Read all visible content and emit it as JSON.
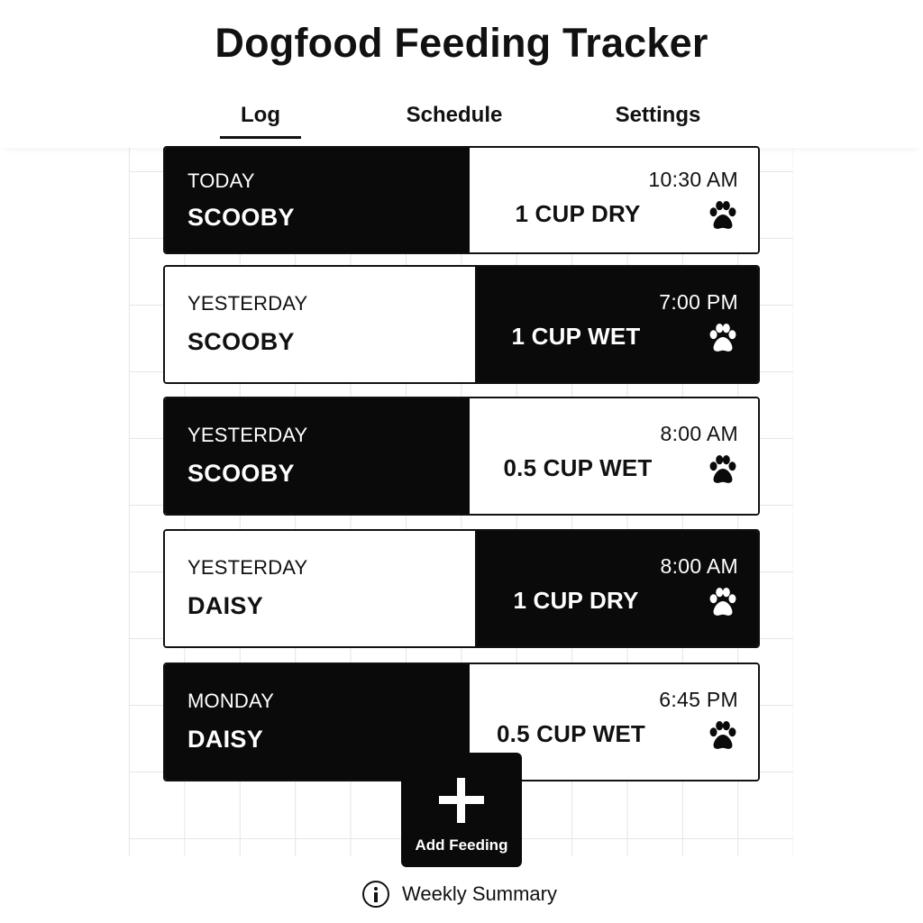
{
  "app": {
    "title": "Dogfood Feeding Tracker"
  },
  "tabs": [
    {
      "label": "Log",
      "active": true
    },
    {
      "label": "Schedule",
      "active": false
    },
    {
      "label": "Settings",
      "active": false
    }
  ],
  "entries": [
    {
      "day": "TODAY",
      "dog": "SCOOBY",
      "time": "10:30 AM",
      "amount": "1 CUP DRY",
      "icon": "paw-icon"
    },
    {
      "day": "YESTERDAY",
      "dog": "SCOOBY",
      "time": "7:00 PM",
      "amount": "1 CUP WET",
      "icon": "paw-icon"
    },
    {
      "day": "YESTERDAY",
      "dog": "SCOOBY",
      "time": "8:00 AM",
      "amount": "0.5 CUP WET",
      "icon": "paw-icon"
    },
    {
      "day": "YESTERDAY",
      "dog": "DAISY",
      "time": "8:00 AM",
      "amount": "1 CUP DRY",
      "icon": "paw-icon"
    },
    {
      "day": "MONDAY",
      "dog": "DAISY",
      "time": "6:45 PM",
      "amount": "0.5 CUP WET",
      "icon": "paw-icon"
    }
  ],
  "actions": {
    "add_feeding_label": "Add Feeding",
    "add_icon": "plus-icon",
    "weekly_summary_label": "Weekly Summary",
    "summary_icon": "info-icon"
  },
  "colors": {
    "dark": "#0a0a0a",
    "light": "#ffffff",
    "grid": "#e3e3e3"
  }
}
